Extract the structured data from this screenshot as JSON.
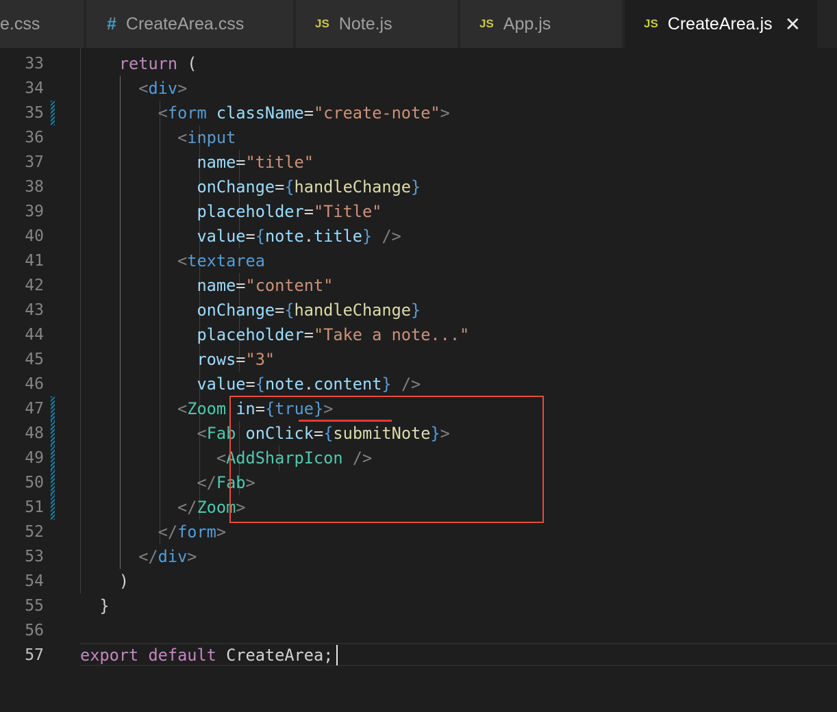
{
  "tabs": [
    {
      "label": "e.css",
      "icon": "css-file-icon",
      "active": false
    },
    {
      "label": "CreateArea.css",
      "icon": "hash-icon",
      "icon_glyph": "#",
      "active": false
    },
    {
      "label": "Note.js",
      "icon": "js-file-icon",
      "icon_glyph": "JS",
      "active": false
    },
    {
      "label": "App.js",
      "icon": "js-file-icon",
      "icon_glyph": "JS",
      "active": false
    },
    {
      "label": "CreateArea.js",
      "icon": "js-file-icon",
      "icon_glyph": "JS",
      "active": true,
      "close_glyph": "✕"
    }
  ],
  "editor": {
    "current_line": 57,
    "highlight": {
      "color": "#e74c3c",
      "from_line": 47,
      "to_line": 51,
      "underlined_text": "in={true}"
    },
    "modified_lines": [
      35,
      47,
      48,
      49,
      50,
      51
    ],
    "lines": [
      {
        "num": "33",
        "tokens": [
          [
            "    ",
            "w"
          ],
          [
            "return",
            "k"
          ],
          [
            " (",
            "w"
          ]
        ]
      },
      {
        "num": "34",
        "tokens": [
          [
            "      ",
            "w"
          ],
          [
            "<",
            "p"
          ],
          [
            "div",
            "t"
          ],
          [
            ">",
            "p"
          ]
        ]
      },
      {
        "num": "35",
        "tokens": [
          [
            "        ",
            "w"
          ],
          [
            "<",
            "p"
          ],
          [
            "form",
            "t"
          ],
          [
            " ",
            "w"
          ],
          [
            "className",
            "a"
          ],
          [
            "=",
            "w"
          ],
          [
            "\"create-note\"",
            "s"
          ],
          [
            ">",
            "p"
          ]
        ]
      },
      {
        "num": "36",
        "tokens": [
          [
            "          ",
            "w"
          ],
          [
            "<",
            "p"
          ],
          [
            "input",
            "t"
          ]
        ]
      },
      {
        "num": "37",
        "tokens": [
          [
            "            ",
            "w"
          ],
          [
            "name",
            "a"
          ],
          [
            "=",
            "w"
          ],
          [
            "\"title\"",
            "s"
          ]
        ]
      },
      {
        "num": "38",
        "tokens": [
          [
            "            ",
            "w"
          ],
          [
            "onChange",
            "a"
          ],
          [
            "=",
            "w"
          ],
          [
            "{",
            "vb"
          ],
          [
            "handleChange",
            "f"
          ],
          [
            "}",
            "vb"
          ]
        ]
      },
      {
        "num": "39",
        "tokens": [
          [
            "            ",
            "w"
          ],
          [
            "placeholder",
            "a"
          ],
          [
            "=",
            "w"
          ],
          [
            "\"Title\"",
            "s"
          ]
        ]
      },
      {
        "num": "40",
        "tokens": [
          [
            "            ",
            "w"
          ],
          [
            "value",
            "a"
          ],
          [
            "=",
            "w"
          ],
          [
            "{",
            "vb"
          ],
          [
            "note",
            "a"
          ],
          [
            ".",
            "w"
          ],
          [
            "title",
            "a"
          ],
          [
            "}",
            "vb"
          ],
          [
            " />",
            "p"
          ]
        ]
      },
      {
        "num": "41",
        "tokens": [
          [
            "          ",
            "w"
          ],
          [
            "<",
            "p"
          ],
          [
            "textarea",
            "t"
          ]
        ]
      },
      {
        "num": "42",
        "tokens": [
          [
            "            ",
            "w"
          ],
          [
            "name",
            "a"
          ],
          [
            "=",
            "w"
          ],
          [
            "\"content\"",
            "s"
          ]
        ]
      },
      {
        "num": "43",
        "tokens": [
          [
            "            ",
            "w"
          ],
          [
            "onChange",
            "a"
          ],
          [
            "=",
            "w"
          ],
          [
            "{",
            "vb"
          ],
          [
            "handleChange",
            "f"
          ],
          [
            "}",
            "vb"
          ]
        ]
      },
      {
        "num": "44",
        "tokens": [
          [
            "            ",
            "w"
          ],
          [
            "placeholder",
            "a"
          ],
          [
            "=",
            "w"
          ],
          [
            "\"Take a note...\"",
            "s"
          ]
        ]
      },
      {
        "num": "45",
        "tokens": [
          [
            "            ",
            "w"
          ],
          [
            "rows",
            "a"
          ],
          [
            "=",
            "w"
          ],
          [
            "\"3\"",
            "s"
          ]
        ]
      },
      {
        "num": "46",
        "tokens": [
          [
            "            ",
            "w"
          ],
          [
            "value",
            "a"
          ],
          [
            "=",
            "w"
          ],
          [
            "{",
            "vb"
          ],
          [
            "note",
            "a"
          ],
          [
            ".",
            "w"
          ],
          [
            "content",
            "a"
          ],
          [
            "}",
            "vb"
          ],
          [
            " />",
            "p"
          ]
        ]
      },
      {
        "num": "47",
        "tokens": [
          [
            "          ",
            "w"
          ],
          [
            "<",
            "p"
          ],
          [
            "Zoom",
            "c"
          ],
          [
            " ",
            "w"
          ],
          [
            "in",
            "a"
          ],
          [
            "=",
            "w"
          ],
          [
            "{",
            "vb"
          ],
          [
            "true",
            "t"
          ],
          [
            "}",
            "vb"
          ],
          [
            ">",
            "p"
          ]
        ]
      },
      {
        "num": "48",
        "tokens": [
          [
            "            ",
            "w"
          ],
          [
            "<",
            "p"
          ],
          [
            "Fab",
            "c"
          ],
          [
            " ",
            "w"
          ],
          [
            "onClick",
            "a"
          ],
          [
            "=",
            "w"
          ],
          [
            "{",
            "vb"
          ],
          [
            "submitNote",
            "f"
          ],
          [
            "}",
            "vb"
          ],
          [
            ">",
            "p"
          ]
        ]
      },
      {
        "num": "49",
        "tokens": [
          [
            "              ",
            "w"
          ],
          [
            "<",
            "p"
          ],
          [
            "AddSharpIcon",
            "c"
          ],
          [
            " />",
            "p"
          ]
        ]
      },
      {
        "num": "50",
        "tokens": [
          [
            "            ",
            "w"
          ],
          [
            "</",
            "p"
          ],
          [
            "Fab",
            "c"
          ],
          [
            ">",
            "p"
          ]
        ]
      },
      {
        "num": "51",
        "tokens": [
          [
            "          ",
            "w"
          ],
          [
            "</",
            "p"
          ],
          [
            "Zoom",
            "c"
          ],
          [
            ">",
            "p"
          ]
        ]
      },
      {
        "num": "52",
        "tokens": [
          [
            "        ",
            "w"
          ],
          [
            "</",
            "p"
          ],
          [
            "form",
            "t"
          ],
          [
            ">",
            "p"
          ]
        ]
      },
      {
        "num": "53",
        "tokens": [
          [
            "      ",
            "w"
          ],
          [
            "</",
            "p"
          ],
          [
            "div",
            "t"
          ],
          [
            ">",
            "p"
          ]
        ]
      },
      {
        "num": "54",
        "tokens": [
          [
            "    ",
            "w"
          ],
          [
            ")",
            "w"
          ]
        ]
      },
      {
        "num": "55",
        "tokens": [
          [
            "  ",
            "w"
          ],
          [
            "}",
            "w"
          ]
        ]
      },
      {
        "num": "56",
        "tokens": []
      },
      {
        "num": "57",
        "tokens": [
          [
            "export",
            "k"
          ],
          [
            " ",
            "w"
          ],
          [
            "default",
            "k"
          ],
          [
            " ",
            "w"
          ],
          [
            "CreateArea",
            "w"
          ],
          [
            ";",
            "w"
          ]
        ]
      }
    ]
  },
  "colors": {
    "keyword": "#c586c0",
    "tag": "#569cd6",
    "component": "#4ec9b0",
    "attribute": "#9cdcfe",
    "string": "#ce9178",
    "function": "#dcdcaa",
    "punctuation": "#808080",
    "text": "#d4d4d4"
  }
}
